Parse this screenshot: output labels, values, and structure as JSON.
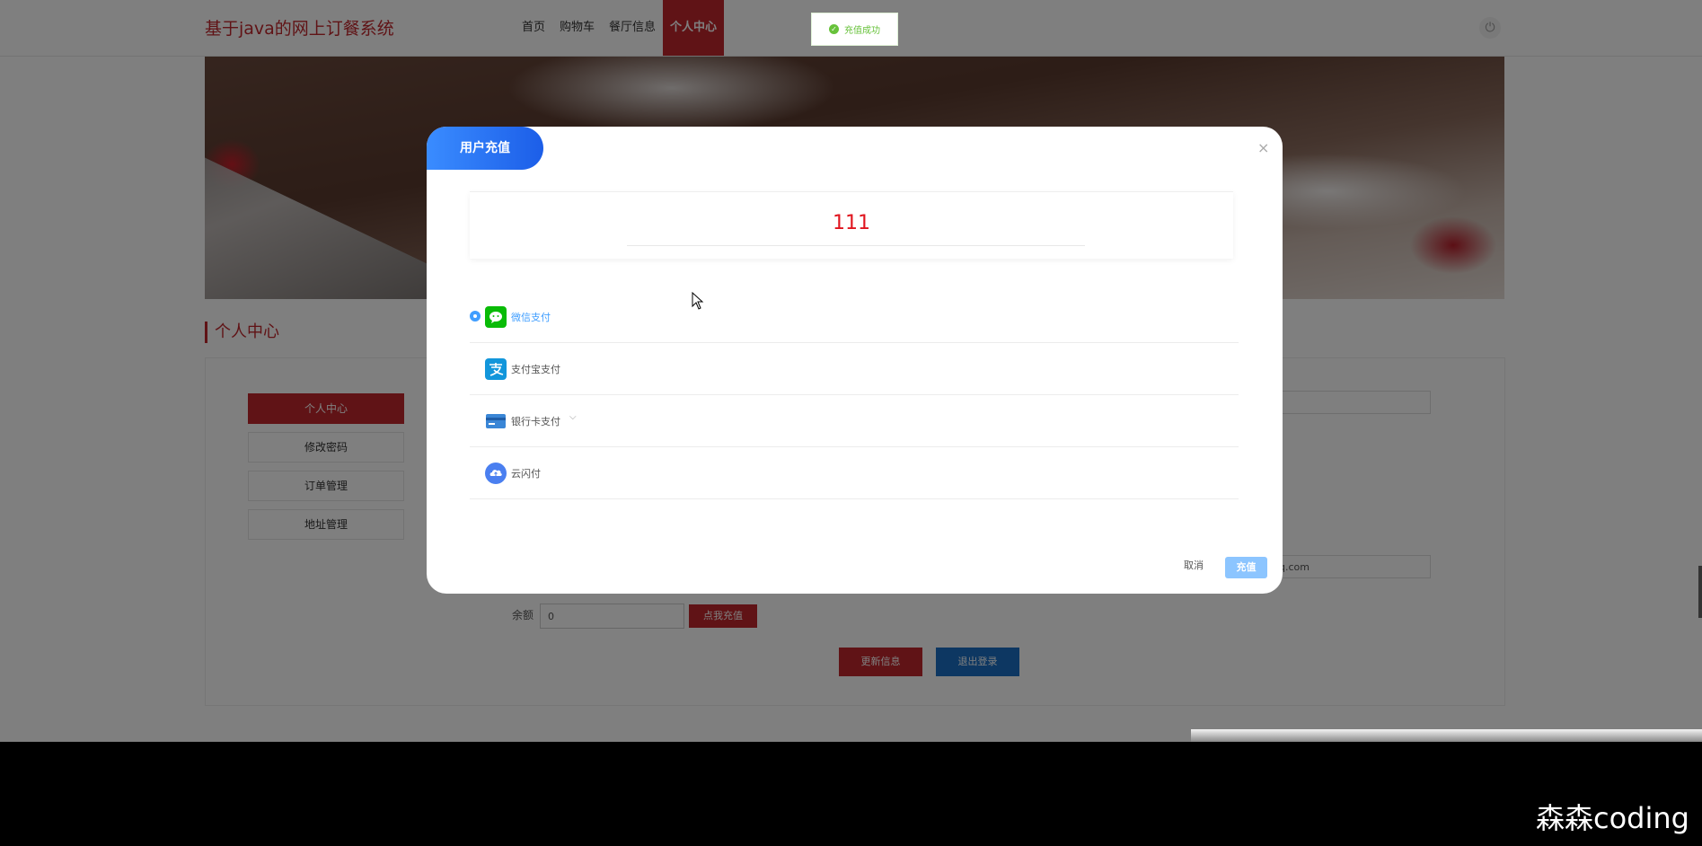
{
  "header": {
    "logo": "基于java的网上订餐系统",
    "nav": [
      {
        "label": "首页"
      },
      {
        "label": "购物车"
      },
      {
        "label": "餐厅信息"
      },
      {
        "label": "个人中心",
        "active": true
      }
    ]
  },
  "section": {
    "title": "个人中心"
  },
  "side_menu": [
    {
      "label": "个人中心",
      "active": true
    },
    {
      "label": "修改密码"
    },
    {
      "label": "订单管理"
    },
    {
      "label": "地址管理"
    }
  ],
  "form": {
    "email_value": "qq.com",
    "balance_label": "余额",
    "balance_value": "0",
    "recharge_button": "点我充值",
    "update_button": "更新信息",
    "logout_button": "退出登录"
  },
  "toast": {
    "text": "充值成功"
  },
  "dialog": {
    "title": "用户充值",
    "close": "×",
    "amount": "111",
    "payment_methods": [
      {
        "label": "微信支付",
        "icon": "wechat-pay-icon",
        "selected": true
      },
      {
        "label": "支付宝支付",
        "icon": "alipay-icon",
        "selected": false
      },
      {
        "label": "银行卡支付",
        "icon": "bank-card-icon",
        "selected": false,
        "dropdown": true
      },
      {
        "label": "云闪付",
        "icon": "union-cloud-pay-icon",
        "selected": false
      }
    ],
    "cancel_button": "取消",
    "confirm_button": "充值"
  },
  "watermark": "森森coding",
  "colors": {
    "brand_red": "#c1272d",
    "primary_blue": "#409eff",
    "success_green": "#67c23a",
    "amount_red": "#e0141e"
  }
}
